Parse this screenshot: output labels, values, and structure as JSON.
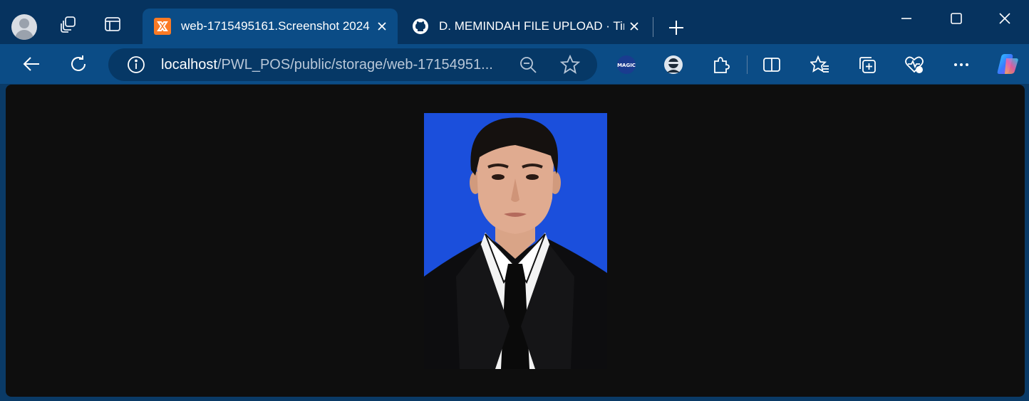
{
  "tabs": [
    {
      "label": "web-1715495161.Screenshot 2024",
      "favicon": "xampp-icon",
      "active": true
    },
    {
      "label": "D. MEMINDAH FILE UPLOAD · Tim",
      "favicon": "github-icon",
      "active": false
    }
  ],
  "address_bar": {
    "host": "localhost",
    "path": "/PWL_POS/public/storage/web-17154951..."
  },
  "toolbar": {
    "extension_label": "MAGIC"
  },
  "colors": {
    "titlebar": "#06335f",
    "toolbar": "#0b4c86",
    "content_bg": "#0e0e0e",
    "photo_background": "#1b4fdc"
  },
  "icons": [
    "profile-avatar",
    "workspaces-icon",
    "tab-actions-icon",
    "close-icon",
    "new-tab-icon",
    "minimize-icon",
    "maximize-icon",
    "back-icon",
    "refresh-icon",
    "info-icon",
    "zoom-icon",
    "favorite-star-icon",
    "extensions-icon",
    "split-screen-icon",
    "favorites-icon",
    "collections-icon",
    "browser-essentials-icon",
    "more-icon",
    "copilot-icon"
  ]
}
